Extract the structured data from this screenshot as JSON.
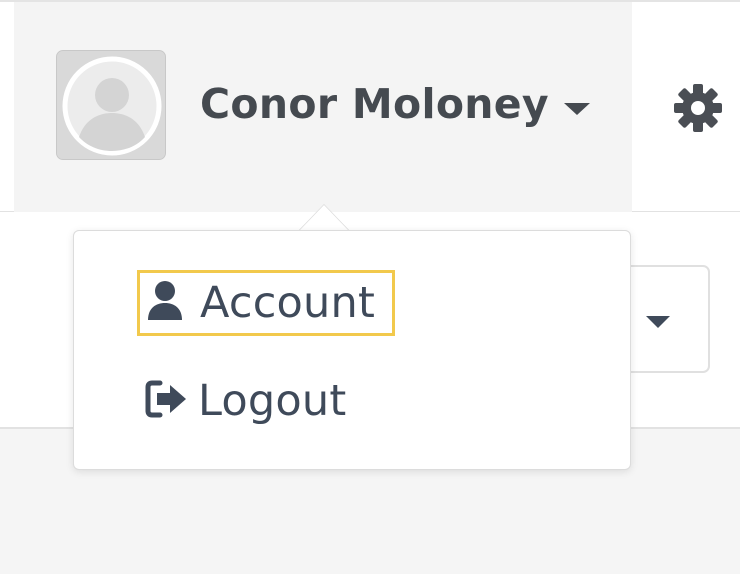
{
  "header": {
    "user_name": "Conor Moloney",
    "icons": {
      "avatar": "avatar-placeholder-icon",
      "caret": "caret-down-icon",
      "settings": "gear-icon"
    }
  },
  "dropdown": {
    "items": [
      {
        "label": "Account",
        "icon": "user-icon",
        "focused": true
      },
      {
        "label": "Logout",
        "icon": "logout-icon",
        "focused": false
      }
    ]
  },
  "colors": {
    "focus_outline": "#f2c94c",
    "text": "#3f4a5a",
    "header_bg": "#f4f4f4"
  }
}
